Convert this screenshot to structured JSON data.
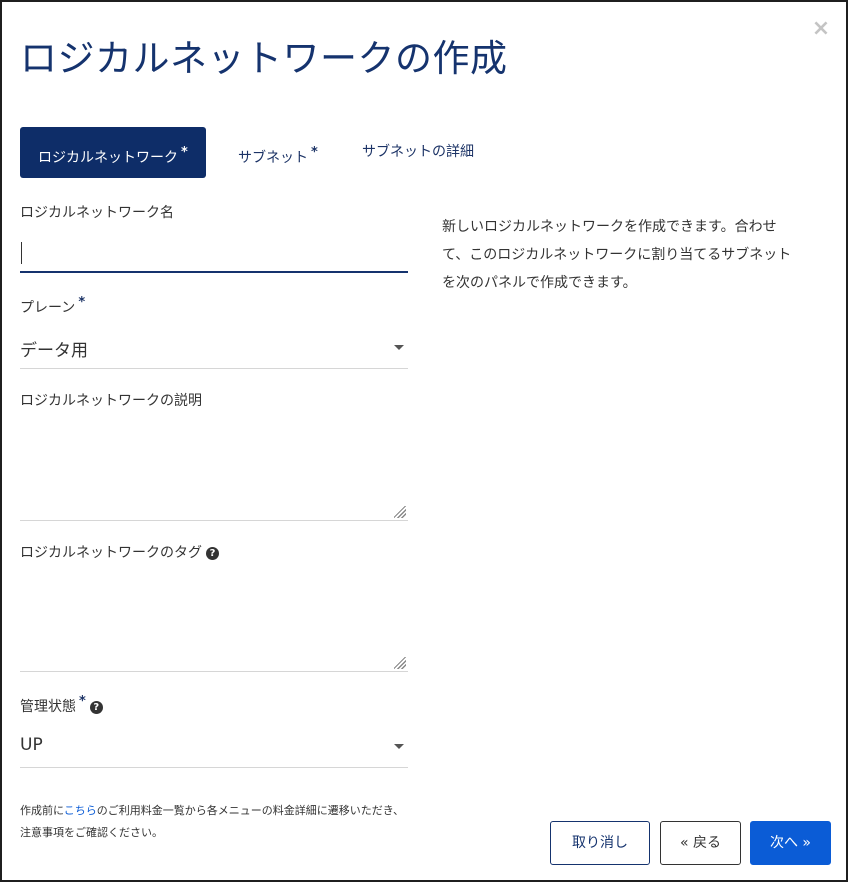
{
  "dialog": {
    "title": "ロジカルネットワークの作成",
    "close_icon": "×"
  },
  "tabs": [
    {
      "label": "ロジカルネットワーク",
      "required": "*",
      "active": true
    },
    {
      "label": "サブネット",
      "required": "*",
      "active": false
    },
    {
      "label": "サブネットの詳細",
      "required": "",
      "active": false
    }
  ],
  "form": {
    "name": {
      "label": "ロジカルネットワーク名",
      "value": ""
    },
    "plane": {
      "label": "プレーン",
      "required": "*",
      "value": "データ用"
    },
    "description": {
      "label": "ロジカルネットワークの説明",
      "value": ""
    },
    "tags": {
      "label": "ロジカルネットワークのタグ",
      "help_icon": "?",
      "value": ""
    },
    "admin_state": {
      "label": "管理状態",
      "required": "*",
      "help_icon": "?",
      "value": "UP"
    }
  },
  "help_text": [
    "新しいロジカルネットワークを作成できます。合わせ",
    "て、このロジカルネットワークに割り当てるサブネット",
    "を次のパネルで作成できます。"
  ],
  "footnote": {
    "prefix": "作成前に",
    "link": "こちら",
    "suffix": "のご利用料金一覧から各メニューの料金詳細に遷移いただき、",
    "line2": "注意事項をご確認ください。"
  },
  "buttons": {
    "cancel": "取り消し",
    "back": "« 戻る",
    "next": "次へ »"
  },
  "colors": {
    "primary": "#0e2d68",
    "accent": "#0b5cd6",
    "title": "#15336e"
  }
}
